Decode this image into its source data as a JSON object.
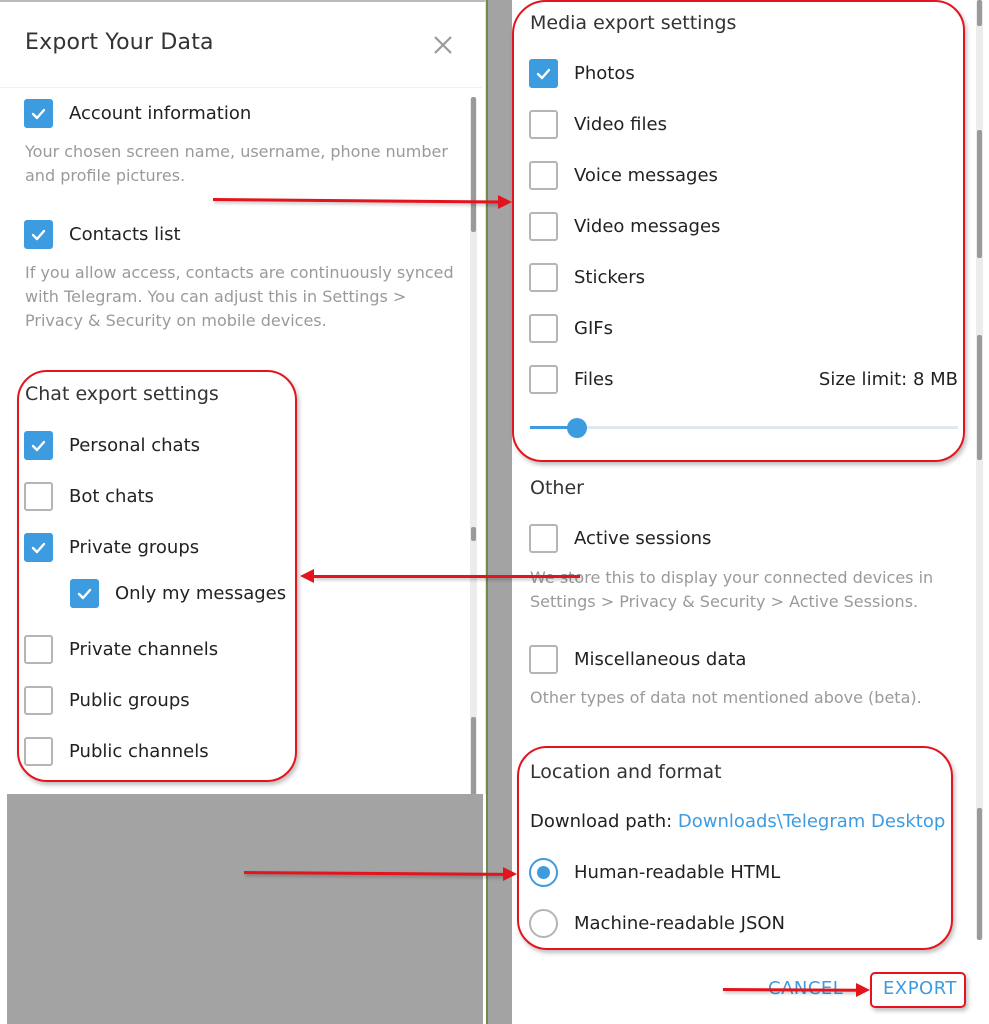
{
  "dialog": {
    "title": "Export Your Data",
    "close_icon": "close-icon"
  },
  "account": {
    "label": "Account information",
    "checked": true,
    "description_line1": "Your chosen screen name, username, phone number",
    "description_line2": "and profile pictures."
  },
  "contacts": {
    "label": "Contacts list",
    "checked": true,
    "description_line1": "If you allow access, contacts are continuously synced",
    "description_line2": "with Telegram. You can adjust this in Settings >",
    "description_line3": "Privacy & Security on mobile devices."
  },
  "chat_export": {
    "heading": "Chat export settings",
    "items": [
      {
        "label": "Personal chats",
        "checked": true
      },
      {
        "label": "Bot chats",
        "checked": false
      },
      {
        "label": "Private groups",
        "checked": true
      },
      {
        "label": "Only my messages",
        "checked": true
      },
      {
        "label": "Private channels",
        "checked": false
      },
      {
        "label": "Public groups",
        "checked": false
      },
      {
        "label": "Public channels",
        "checked": false
      }
    ]
  },
  "media_export": {
    "heading": "Media export settings",
    "items": [
      {
        "label": "Photos",
        "checked": true
      },
      {
        "label": "Video files",
        "checked": false
      },
      {
        "label": "Voice messages",
        "checked": false
      },
      {
        "label": "Video messages",
        "checked": false
      },
      {
        "label": "Stickers",
        "checked": false
      },
      {
        "label": "GIFs",
        "checked": false
      },
      {
        "label": "Files",
        "checked": false
      }
    ],
    "size_limit_label": "Size limit: 8 MB",
    "size_limit_slider_fraction": 0.11
  },
  "other": {
    "heading": "Other",
    "active_sessions": {
      "label": "Active sessions",
      "checked": false,
      "description_line1": "We store this to display your connected devices in",
      "description_line2": "Settings > Privacy & Security > Active Sessions."
    },
    "misc": {
      "label": "Miscellaneous data",
      "checked": false,
      "description": "Other types of data not mentioned above (beta)."
    }
  },
  "location_format": {
    "heading": "Location and format",
    "download_path_label": "Download path:",
    "download_path_value": "Downloads\\Telegram Desktop",
    "formats": [
      {
        "label": "Human-readable HTML",
        "selected": true
      },
      {
        "label": "Machine-readable JSON",
        "selected": false
      }
    ]
  },
  "footer": {
    "cancel_label": "CANCEL",
    "export_label": "EXPORT"
  },
  "colors": {
    "accent": "#3d9be0",
    "annotation": "#e3141e",
    "description_text": "#9a9a9a"
  }
}
